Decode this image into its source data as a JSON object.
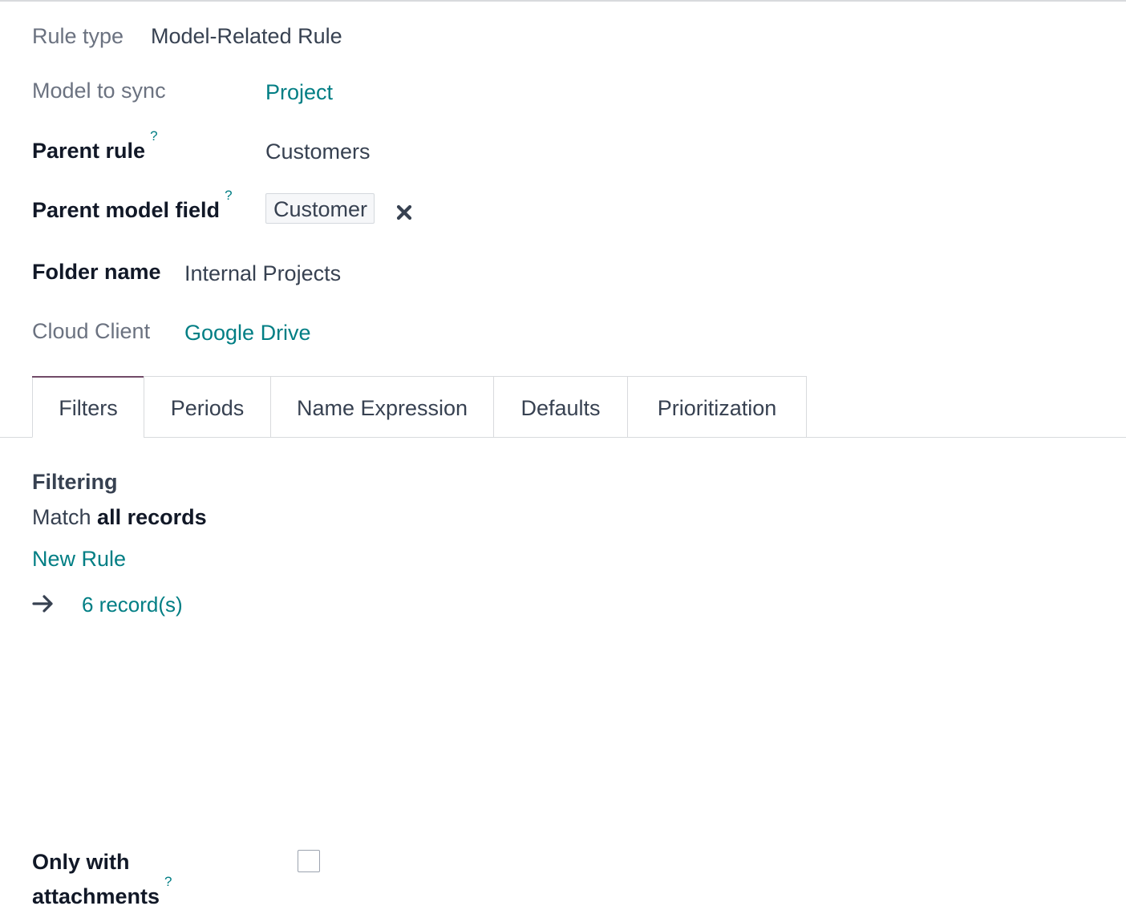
{
  "form": {
    "rule_type": {
      "label": "Rule type",
      "value": "Model-Related Rule"
    },
    "model_to_sync": {
      "label": "Model to sync",
      "value": "Project"
    },
    "parent_rule": {
      "label": "Parent rule",
      "help": "?",
      "value": "Customers"
    },
    "parent_model_field": {
      "label": "Parent model field",
      "help": "?",
      "value": "Customer",
      "remove_icon": "close-icon"
    },
    "folder_name": {
      "label": "Folder name",
      "value": "Internal Projects"
    },
    "cloud_client": {
      "label": "Cloud Client",
      "value": "Google Drive"
    }
  },
  "tabs": [
    {
      "label": "Filters",
      "active": true
    },
    {
      "label": "Periods",
      "active": false
    },
    {
      "label": "Name Expression",
      "active": false
    },
    {
      "label": "Defaults",
      "active": false
    },
    {
      "label": "Prioritization",
      "active": false
    }
  ],
  "filters": {
    "title": "Filtering",
    "match_prefix": "Match",
    "match_value": "all records",
    "new_rule": "New Rule",
    "arrow_icon": "arrow-right-icon",
    "records_link": "6 record(s)"
  },
  "attachments": {
    "label_line1": "Only with",
    "label_line2": "attachments",
    "help": "?",
    "checked": false
  },
  "colors": {
    "accent": "#017e84",
    "active_tab": "#714b67",
    "text": "#374151"
  }
}
